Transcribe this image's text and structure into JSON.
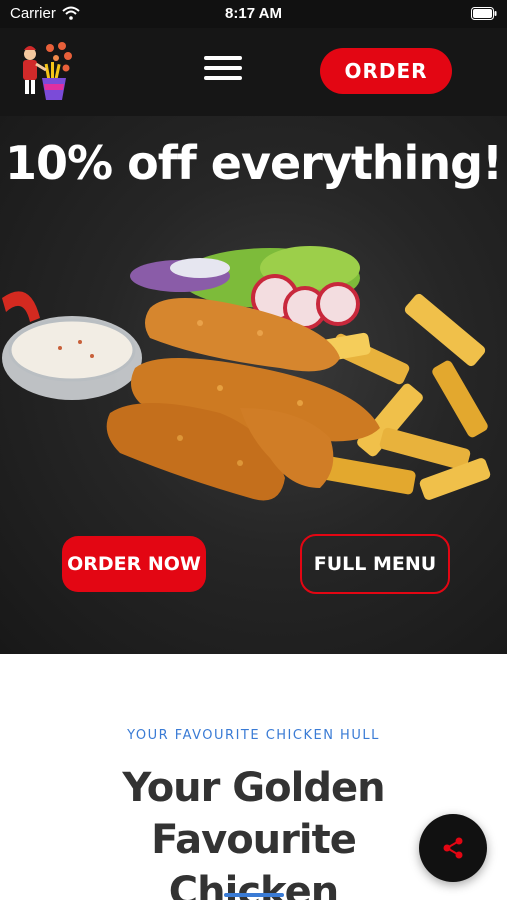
{
  "status_bar": {
    "carrier": "Carrier",
    "time": "8:17 AM"
  },
  "header": {
    "order_label": "ORDER",
    "menu_icon": "hamburger-menu-icon",
    "logo_icon": "chicken-fries-mascot-logo"
  },
  "hero": {
    "title": "10% off everything!",
    "order_now_label": "ORDER NOW",
    "full_menu_label": "FULL MENU"
  },
  "intro": {
    "eyebrow": "YOUR FAVOURITE CHICKEN HULL",
    "title_line1": "Your Golden Favourite",
    "title_line2": "Chicken"
  },
  "fab": {
    "icon": "share-icon"
  },
  "colors": {
    "brand_red": "#e30613",
    "accent_blue": "#3a7bd5",
    "header_bg": "#161616",
    "title_text": "#333333"
  }
}
